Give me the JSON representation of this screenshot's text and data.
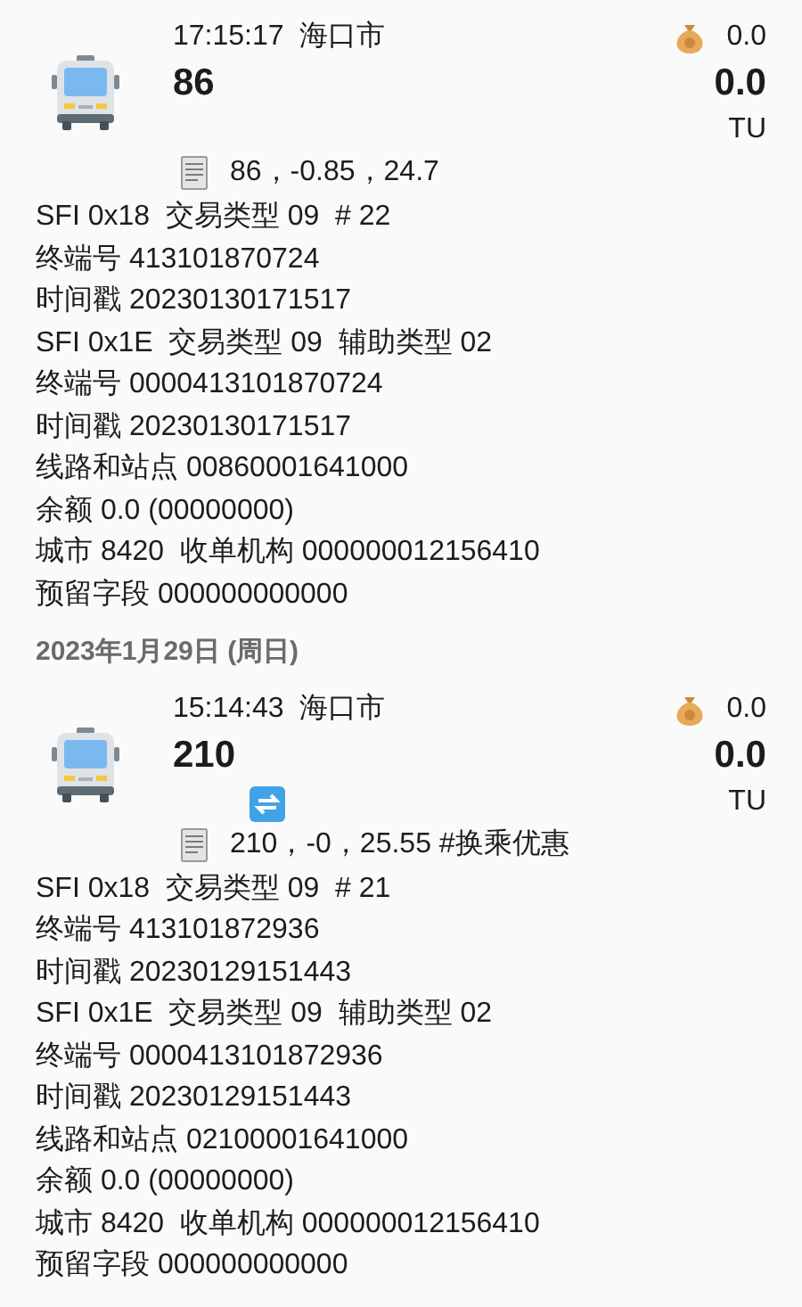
{
  "records": [
    {
      "time": "17:15:17",
      "city": "海口市",
      "route": "86",
      "balance_change": "0.0",
      "amount": "0.0",
      "unit": "TU",
      "transfer": false,
      "memo": "86，-0.85，24.7",
      "details": [
        "SFI 0x18  交易类型 09  # 22",
        "终端号 413101870724",
        "时间戳 20230130171517",
        "SFI 0x1E  交易类型 09  辅助类型 02",
        "终端号 0000413101870724",
        "时间戳 20230130171517",
        "线路和站点 00860001641000",
        "余额 0.0 (00000000)",
        "城市 8420  收单机构 000000012156410",
        "预留字段 000000000000"
      ]
    },
    {
      "date_header": "2023年1月29日 (周日)",
      "time": "15:14:43",
      "city": "海口市",
      "route": "210",
      "balance_change": "0.0",
      "amount": "0.0",
      "unit": "TU",
      "transfer": true,
      "memo": "210，-0，25.55 #换乘优惠",
      "details": [
        "SFI 0x18  交易类型 09  # 21",
        "终端号 413101872936",
        "时间戳 20230129151443",
        "SFI 0x1E  交易类型 09  辅助类型 02",
        "终端号 0000413101872936",
        "时间戳 20230129151443",
        "线路和站点 02100001641000",
        "余额 0.0 (00000000)",
        "城市 8420  收单机构 000000012156410",
        "预留字段 000000000000"
      ]
    }
  ]
}
